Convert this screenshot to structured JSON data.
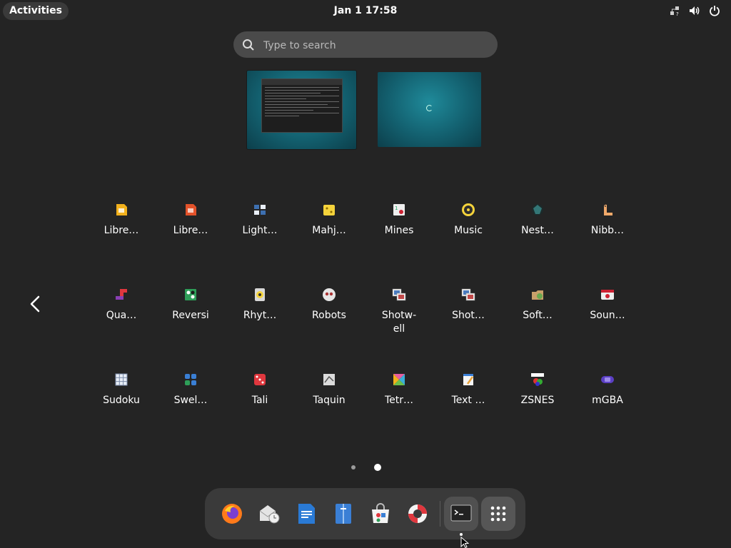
{
  "topbar": {
    "activities_label": "Activities",
    "clock": "Jan 1  17:58",
    "tray_icons": [
      "network-icon",
      "volume-icon",
      "power-icon"
    ]
  },
  "search": {
    "placeholder": "Type to search"
  },
  "app_grid": {
    "rows": [
      [
        "Libre…",
        "Libre…",
        "Light…",
        "Mahj…",
        "Mines",
        "Music",
        "Nest…",
        "Nibb…"
      ],
      [
        "Qua…",
        "Reversi",
        "Rhyt…",
        "Robots",
        "Shotw-\nell",
        "Shot…",
        "Soft…",
        "Soun…"
      ],
      [
        "Sudoku",
        "Swel…",
        "Tali",
        "Taquin",
        "Tetr…",
        "Text …",
        "ZSNES",
        "mGBA"
      ]
    ]
  },
  "pagination": {
    "pages": 2,
    "current": 2
  },
  "dash": {
    "items": [
      "firefox-icon",
      "mail-clock-icon",
      "writer-icon",
      "notes-icon",
      "software-store-icon",
      "help-lifebuoy-icon",
      "terminal-icon",
      "show-apps-icon"
    ]
  },
  "colors": {
    "background": "#242424",
    "panel": "#3a3a3a",
    "search_bg": "#4a4a4a"
  }
}
